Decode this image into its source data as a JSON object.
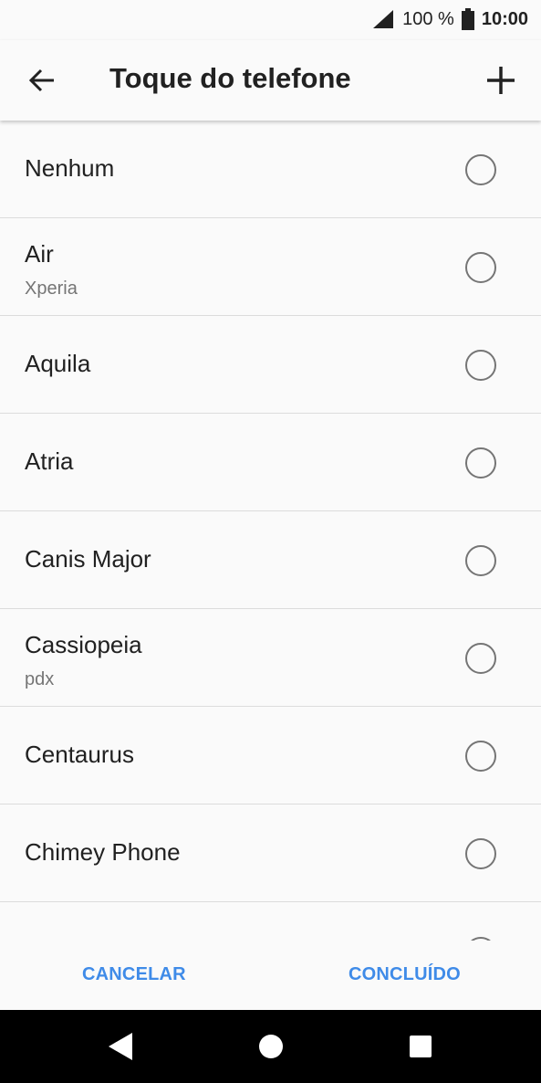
{
  "status_bar": {
    "battery": "100 %",
    "time": "10:00",
    "icons": [
      "signal-icon",
      "battery-icon"
    ]
  },
  "app_bar": {
    "title": "Toque do telefone",
    "back_icon": "arrow-left-icon",
    "add_icon": "plus-icon"
  },
  "ringtones": [
    {
      "name": "Nenhum",
      "subtitle": "",
      "selected": false
    },
    {
      "name": "Air",
      "subtitle": "Xperia",
      "selected": false
    },
    {
      "name": "Aquila",
      "subtitle": "",
      "selected": false
    },
    {
      "name": "Atria",
      "subtitle": "",
      "selected": false
    },
    {
      "name": "Canis Major",
      "subtitle": "",
      "selected": false
    },
    {
      "name": "Cassiopeia",
      "subtitle": "pdx",
      "selected": false
    },
    {
      "name": "Centaurus",
      "subtitle": "",
      "selected": false
    },
    {
      "name": "Chimey Phone",
      "subtitle": "",
      "selected": false
    }
  ],
  "actions": {
    "cancel": "CANCELAR",
    "done": "CONCLUÍDO"
  },
  "colors": {
    "accent": "#3f8be8",
    "radio": "#757575",
    "divider": "#dcdcdc"
  },
  "nav_bar": {
    "icons": [
      "back-triangle-icon",
      "home-circle-icon",
      "recents-square-icon"
    ]
  }
}
